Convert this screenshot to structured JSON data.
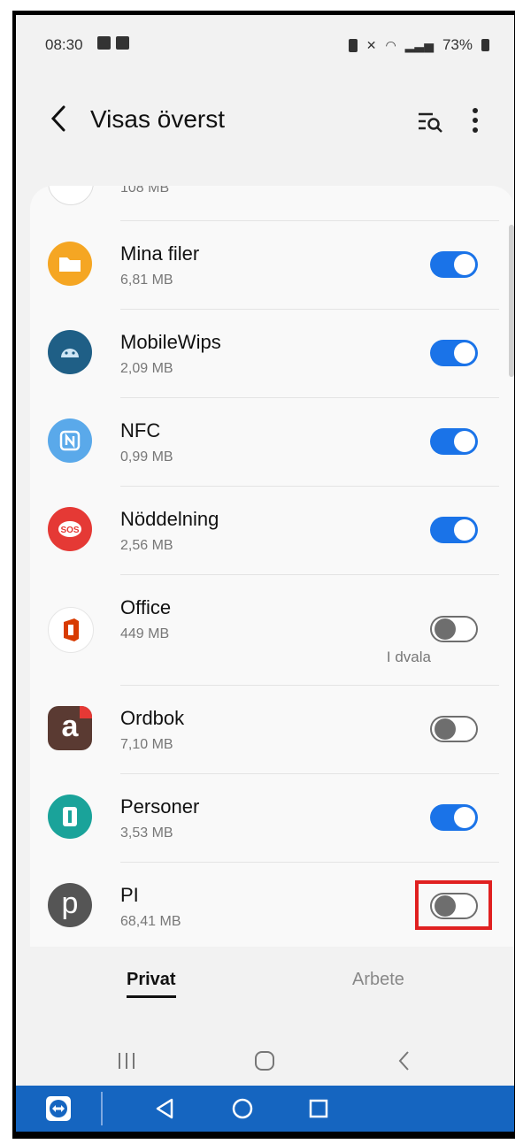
{
  "status_bar": {
    "time": "08:30",
    "battery": "73%"
  },
  "header": {
    "title": "Visas överst"
  },
  "apps": [
    {
      "name": "",
      "size": "108 MB",
      "toggle": "off",
      "note": ""
    },
    {
      "name": "Mina filer",
      "size": "6,81 MB",
      "toggle": "on",
      "note": ""
    },
    {
      "name": "MobileWips",
      "size": "2,09 MB",
      "toggle": "on",
      "note": ""
    },
    {
      "name": "NFC",
      "size": "0,99 MB",
      "toggle": "on",
      "note": ""
    },
    {
      "name": "Nöddelning",
      "size": "2,56 MB",
      "toggle": "on",
      "note": ""
    },
    {
      "name": "Office",
      "size": "449 MB",
      "toggle": "off",
      "note": "I dvala"
    },
    {
      "name": "Ordbok",
      "size": "7,10 MB",
      "toggle": "off",
      "note": ""
    },
    {
      "name": "Personer",
      "size": "3,53 MB",
      "toggle": "on",
      "note": ""
    },
    {
      "name": "PI",
      "size": "68,41 MB",
      "toggle": "off",
      "note": ""
    }
  ],
  "tabs": {
    "active": "Privat",
    "inactive": "Arbete"
  },
  "colors": {
    "accent": "#1a73e8",
    "highlight": "#e02020",
    "teamviewer_bar": "#1565c0"
  }
}
